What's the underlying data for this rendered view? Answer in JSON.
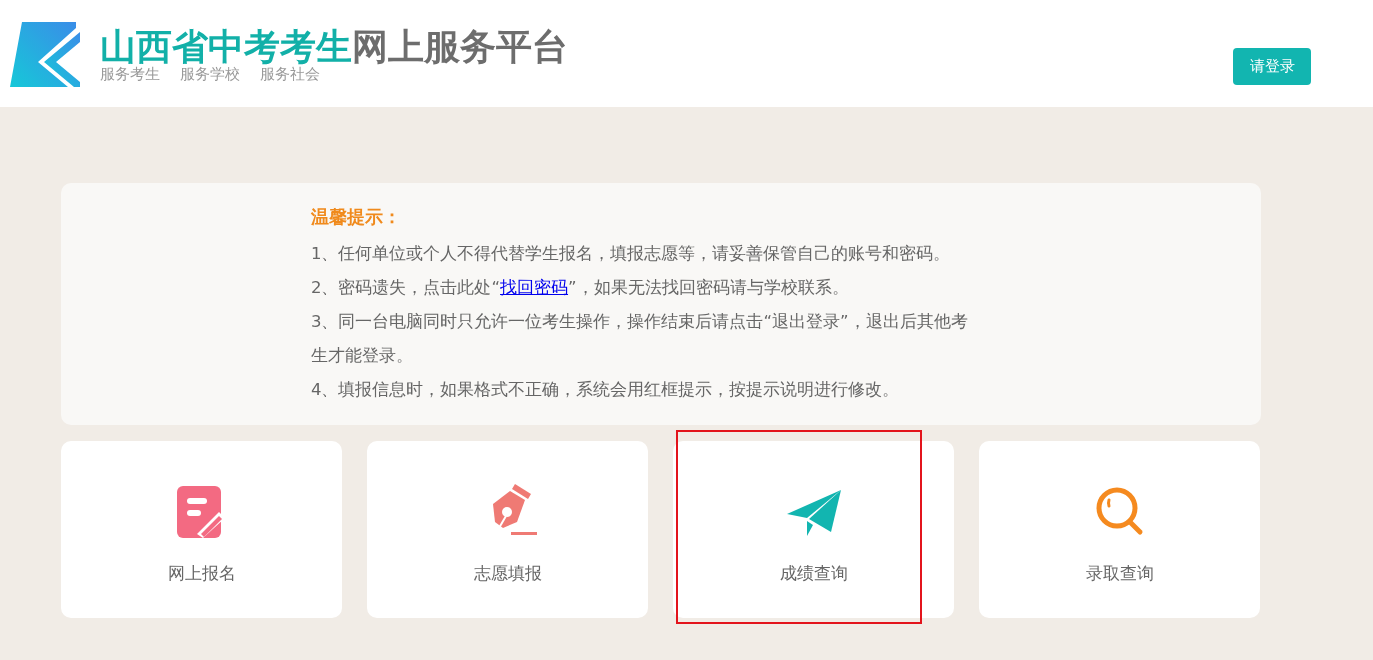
{
  "header": {
    "title_accent": "山西省中考考生",
    "title_rest": "网上服务平台",
    "slogans": [
      "服务考生",
      "服务学校",
      "服务社会"
    ],
    "login_button": "请登录"
  },
  "notice": {
    "title": "温馨提示：",
    "items": [
      {
        "text": "1、任何单位或个人不得代替学生报名，填报志愿等，请妥善保管自己的账号和密码。"
      },
      {
        "text": "2、密码遗失，点击此处“",
        "link": "找回密码",
        "text_after": "”，如果无法找回密码请与学校联系。"
      },
      {
        "text": "3、同一台电脑同时只允许一位考生操作，操作结束后请点击“退出登录”，退出后其他考生才能登录。"
      },
      {
        "text": "4、填报信息时，如果格式不正确，系统会用红框提示，按提示说明进行修改。"
      }
    ]
  },
  "cards": [
    {
      "label": "网上报名",
      "kind": "form",
      "selected": false
    },
    {
      "label": "志愿填报",
      "kind": "pen",
      "selected": false
    },
    {
      "label": "成绩查询",
      "kind": "plane",
      "selected": true
    },
    {
      "label": "录取查询",
      "kind": "search",
      "selected": false
    }
  ]
}
